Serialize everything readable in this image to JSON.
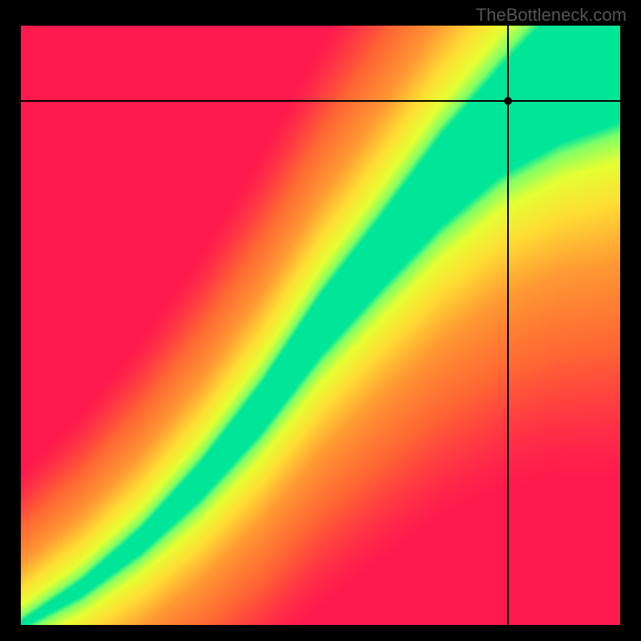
{
  "watermark": "TheBottleneck.com",
  "chart_data": {
    "type": "heatmap",
    "title": "",
    "xlabel": "",
    "ylabel": "",
    "xlim": [
      0,
      1
    ],
    "ylim": [
      0,
      1
    ],
    "crosshair": {
      "x": 0.813,
      "y": 0.875
    },
    "optimal_ridge": [
      {
        "x": 0.0,
        "y": 0.0
      },
      {
        "x": 0.1,
        "y": 0.06
      },
      {
        "x": 0.2,
        "y": 0.14
      },
      {
        "x": 0.3,
        "y": 0.24
      },
      {
        "x": 0.4,
        "y": 0.36
      },
      {
        "x": 0.5,
        "y": 0.5
      },
      {
        "x": 0.6,
        "y": 0.62
      },
      {
        "x": 0.7,
        "y": 0.74
      },
      {
        "x": 0.8,
        "y": 0.84
      },
      {
        "x": 0.9,
        "y": 0.92
      },
      {
        "x": 1.0,
        "y": 0.98
      }
    ],
    "ridge_width": [
      {
        "x": 0.0,
        "w": 0.005
      },
      {
        "x": 0.2,
        "w": 0.02
      },
      {
        "x": 0.4,
        "w": 0.04
      },
      {
        "x": 0.6,
        "w": 0.06
      },
      {
        "x": 0.8,
        "w": 0.09
      },
      {
        "x": 1.0,
        "w": 0.14
      }
    ],
    "color_stops": [
      {
        "t": 0.0,
        "color": "#ff1a4d"
      },
      {
        "t": 0.25,
        "color": "#ff6633"
      },
      {
        "t": 0.5,
        "color": "#ff9933"
      },
      {
        "t": 0.7,
        "color": "#ffdd33"
      },
      {
        "t": 0.85,
        "color": "#e5ff33"
      },
      {
        "t": 0.95,
        "color": "#80ff66"
      },
      {
        "t": 1.0,
        "color": "#00e699"
      }
    ]
  }
}
